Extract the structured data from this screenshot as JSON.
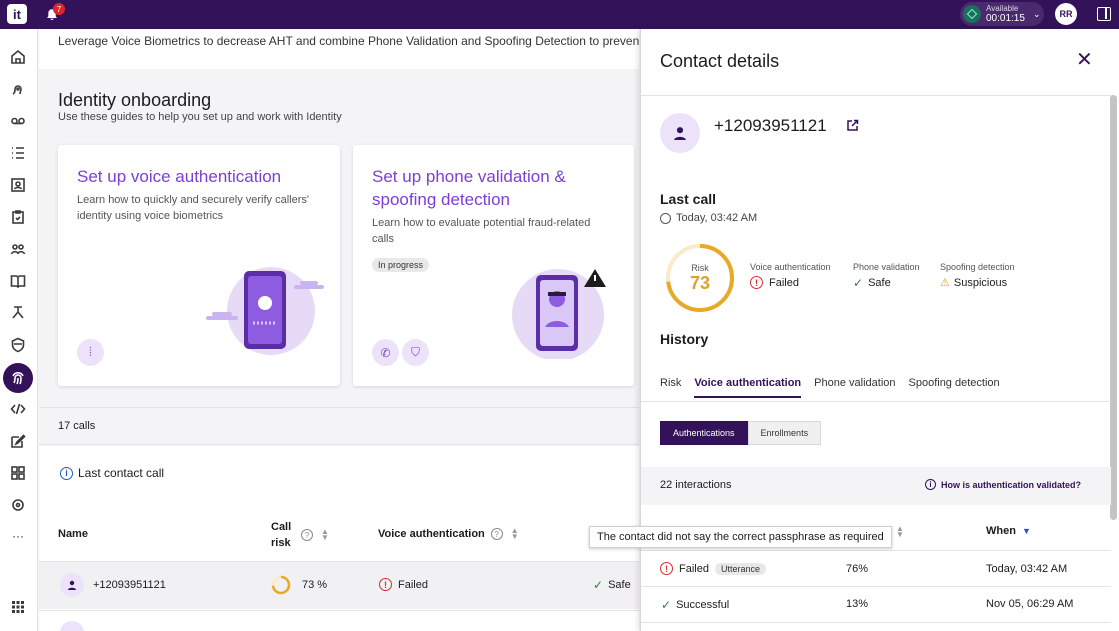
{
  "topbar": {
    "logo": "it",
    "notification_count": "7",
    "status_label": "Available",
    "status_timer": "00:01:15",
    "user_initials": "RR"
  },
  "main": {
    "banner_text": "Leverage Voice Biometrics to decrease AHT and combine Phone Validation and Spoofing Detection to prevent fraud",
    "onboarding_title": "Identity onboarding",
    "onboarding_subtitle": "Use these guides to help you set up and work with Identity",
    "cards": [
      {
        "title": "Set up voice authentication",
        "desc": "Learn how to quickly and securely verify callers' identity using voice biometrics"
      },
      {
        "title": "Set up phone validation & spoofing detection",
        "desc": "Learn how to evaluate potential fraud-related calls",
        "tag": "In progress"
      }
    ],
    "calls_count": "17 calls",
    "last_contact_label": "Last contact call",
    "table": {
      "headers": {
        "name": "Name",
        "risk": "Call risk",
        "voice": "Voice authentication"
      },
      "rows": [
        {
          "name": "+12093951121",
          "risk": "73 %",
          "voice": "Failed",
          "phone": "Safe"
        }
      ]
    }
  },
  "drawer": {
    "title": "Contact details",
    "phone": "+12093951121",
    "last_call_title": "Last call",
    "last_call_time": "Today, 03:42 AM",
    "risk_label": "Risk",
    "risk_value": "73",
    "risk_fraction": 0.73,
    "checks": [
      {
        "label": "Voice authentication",
        "value": "Failed"
      },
      {
        "label": "Phone validation",
        "value": "Safe"
      },
      {
        "label": "Spoofing detection",
        "value": "Suspicious"
      }
    ],
    "history_title": "History",
    "tabs": [
      "Risk",
      "Voice authentication",
      "Phone validation",
      "Spoofing detection"
    ],
    "segments": [
      "Authentications",
      "Enrollments"
    ],
    "interactions": "22 interactions",
    "how_link": "How is authentication validated?",
    "when_header": "When",
    "tooltip": "The contact did not say the correct passphrase as required",
    "rows": [
      {
        "status": "Failed",
        "tag": "Utterance",
        "score": "76%",
        "when": "Today, 03:42 AM"
      },
      {
        "status": "Successful",
        "score": "13%",
        "when": "Nov 05, 06:29 AM"
      }
    ]
  },
  "colors": {
    "brand": "#34125a",
    "accent": "#7b3fd8",
    "danger": "#d32f2f",
    "success": "#2e7d32",
    "warning": "#e0a030"
  }
}
